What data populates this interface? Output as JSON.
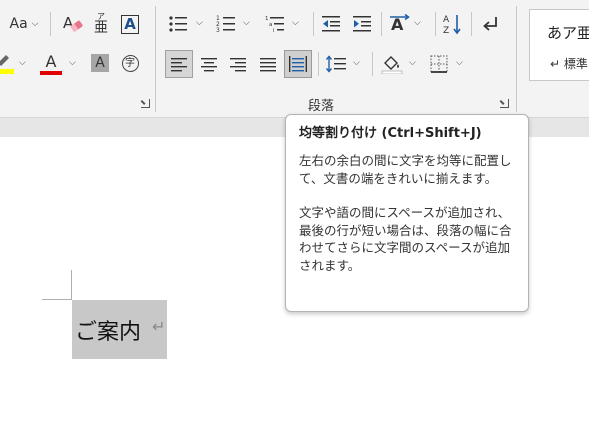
{
  "ribbon": {
    "font_group": {
      "font_size_button": "Aa",
      "phonetic_guide_glyph": "亜",
      "phonetic_guide_ruby": "ア",
      "border_box_glyph": "A",
      "font_color_glyph": "A",
      "char_shading_glyph": "A",
      "enclose_char_glyph": "字"
    },
    "paragraph_group": {
      "label": "段落",
      "selected_tool": "distributed-align"
    },
    "styles_gallery": {
      "sample_text": "あア亜",
      "style_name": "↵ 標準"
    }
  },
  "tooltip": {
    "title": "均等割り付け (Ctrl+Shift+J)",
    "description_1": "左右の余白の間に文字を均等に配置して、文書の端をきれいに揃えます。",
    "description_2": "文字や語の間にスペースが追加され、最後の行が短い場合は、段落の幅に合わせてさらに文字間のスペースが追加されます。"
  },
  "document": {
    "text": "ご案内",
    "paragraph_mark": "↵"
  },
  "colors": {
    "highlight": "#ffff00",
    "font_color": "#e00000",
    "selection": "#c8c8c8"
  }
}
